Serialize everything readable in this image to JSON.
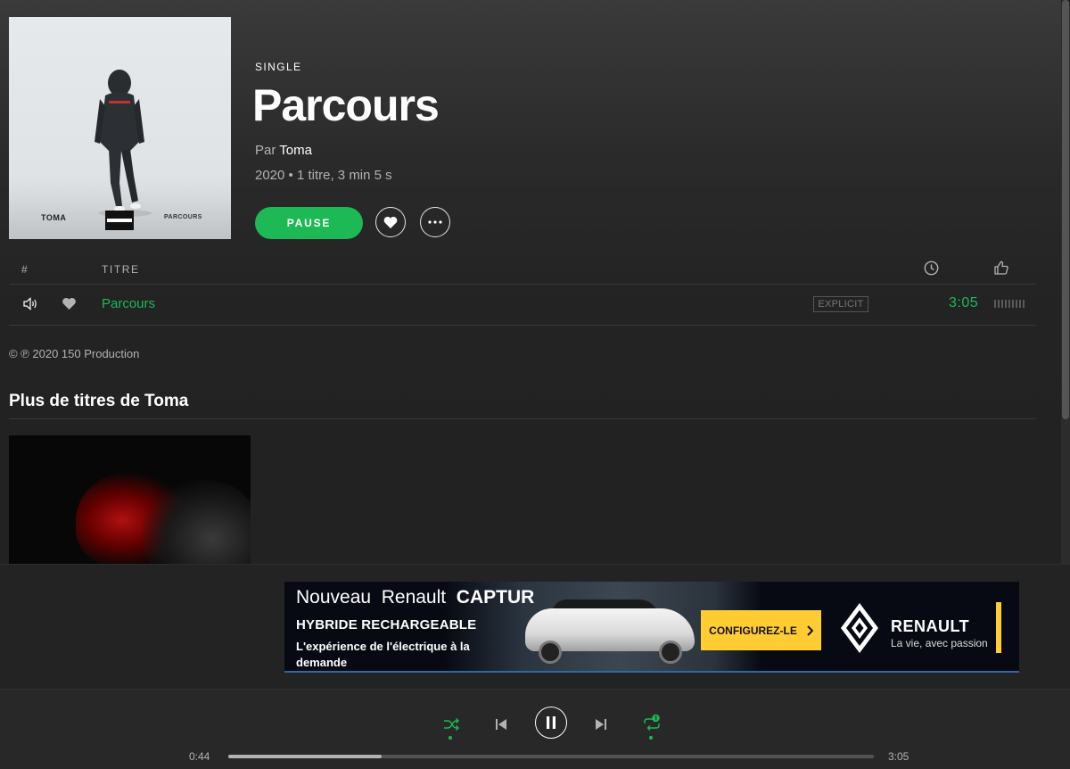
{
  "album": {
    "kind": "SINGLE",
    "title": "Parcours",
    "by_prefix": "Par",
    "artist": "Toma",
    "meta": "2020 • 1 titre, 3 min 5 s",
    "pause_label": "PAUSE",
    "cover_artist_text": "TOMA",
    "cover_title_text": "PARCOURS"
  },
  "tracklist": {
    "col_number": "#",
    "col_title": "TITRE",
    "rows": [
      {
        "title": "Parcours",
        "explicit": "EXPLICIT",
        "duration": "3:05"
      }
    ]
  },
  "copyright": "© ℗ 2020 150 Production",
  "more_section": {
    "title": "Plus de titres de Toma"
  },
  "ad": {
    "line1_a": "Nouveau  Renault  ",
    "line1_b": "CAPTUR",
    "line2": "HYBRIDE RECHARGEABLE",
    "line3": "L'expérience de l'électrique à la demande",
    "cta": "CONFIGUREZ-LE",
    "brand": "RENAULT",
    "slogan": "La vie, avec passion"
  },
  "player": {
    "elapsed": "0:44",
    "total": "3:05",
    "progress_fraction": 0.238
  },
  "icons": {
    "speaker": "speaker-icon",
    "heart": "heart-icon",
    "more": "more-icon",
    "clock": "clock-icon",
    "thumb": "thumbs-up-icon",
    "shuffle": "shuffle-icon",
    "prev": "previous-icon",
    "pause": "pause-icon",
    "next": "next-icon",
    "repeat": "repeat-one-icon"
  },
  "colors": {
    "accent": "#1db954",
    "background": "#121212",
    "ad_cta": "#ffcc33"
  }
}
